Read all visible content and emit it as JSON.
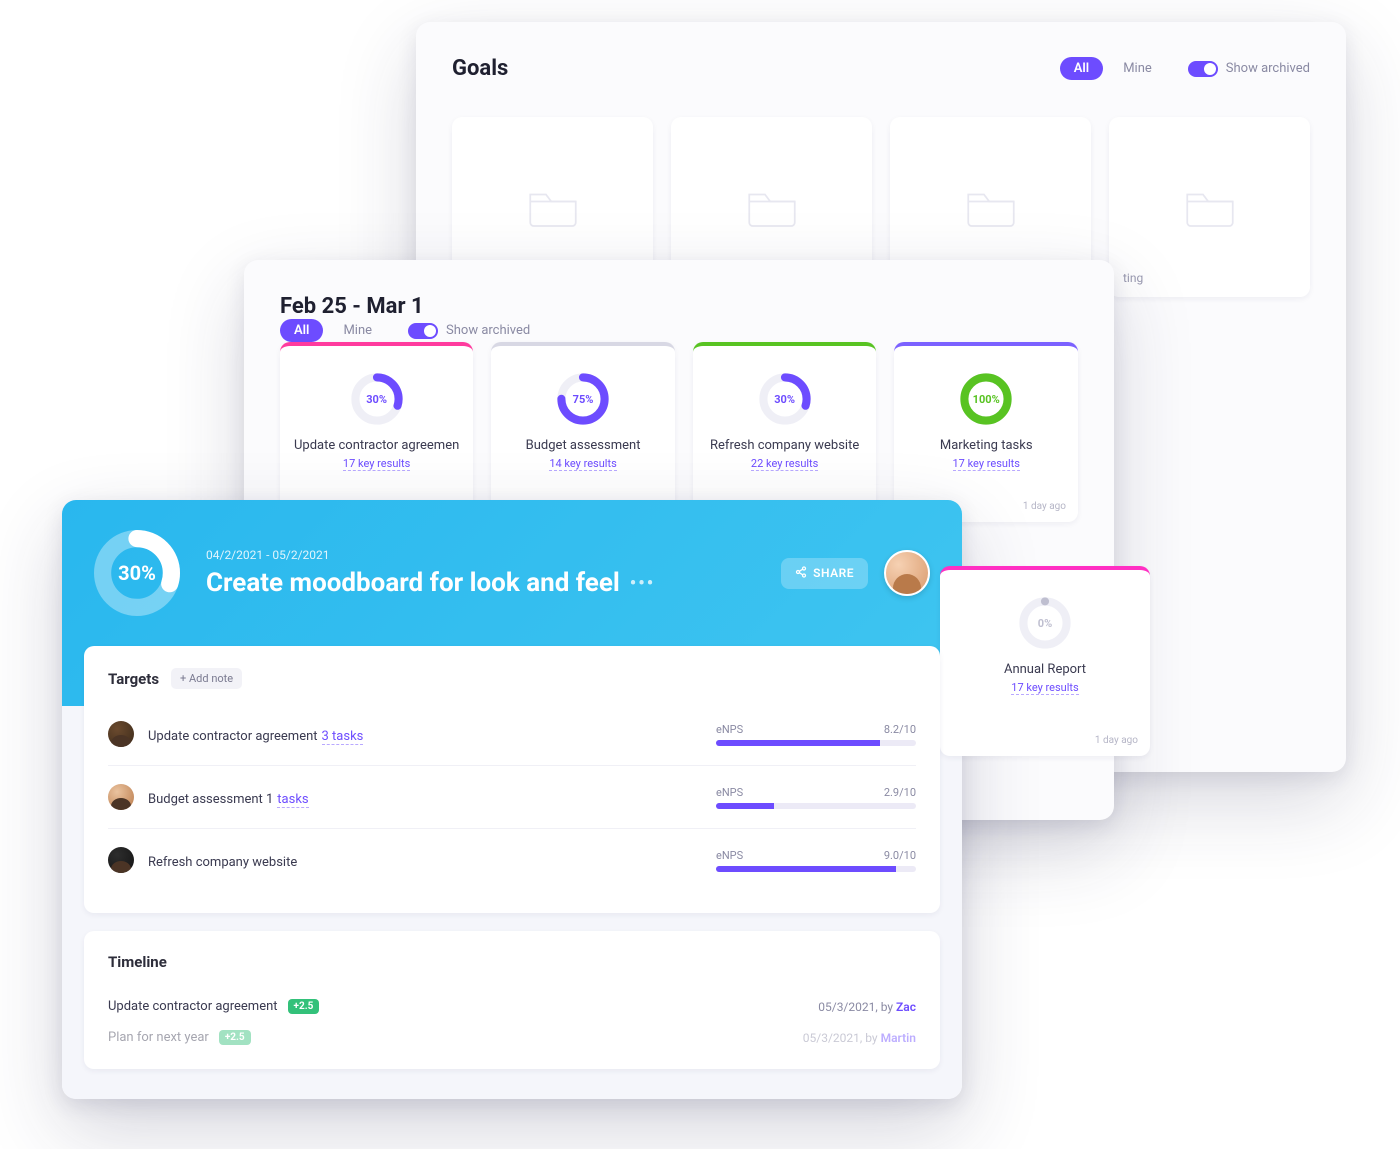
{
  "colors": {
    "accent": "#6d4cff",
    "hero": "#3fc5f0",
    "green": "#58c322",
    "pink": "#ff3b9e",
    "grey": "#bfbfd0"
  },
  "w1": {
    "title": "Goals",
    "filter": {
      "all": "All",
      "mine": "Mine",
      "archived": "Show archived"
    },
    "folders": [
      {
        "caption": ""
      },
      {
        "caption": ""
      },
      {
        "caption": ""
      },
      {
        "caption": "ting"
      }
    ],
    "goals_row2": [
      {
        "name": "Marketing tasks",
        "meta": "17 key results",
        "pct": 100,
        "color": "#58c322",
        "topbar": "#7b61ff",
        "ts": "1 day ago"
      }
    ],
    "extra_col": [
      {
        "pct": 0,
        "color": "#bfbfd0",
        "name": "Annual Report",
        "meta": "17 key results",
        "topbar": "#ff2fc3",
        "ts": "1 day ago"
      }
    ]
  },
  "w2": {
    "title": "Feb 25 - Mar 1",
    "filter": {
      "all": "All",
      "mine": "Mine",
      "archived": "Show archived"
    },
    "goals": [
      {
        "name": "Update contractor agreemen",
        "meta": "17 key results",
        "pct": 30,
        "color": "#6d4cff",
        "topbar": "#ff3b9e"
      },
      {
        "name": "Budget assessment",
        "meta": "14 key results",
        "pct": 75,
        "color": "#6d4cff",
        "topbar": "#d8d8e4"
      },
      {
        "name": "Refresh company website",
        "meta": "22 key results",
        "pct": 30,
        "color": "#6d4cff",
        "topbar": "#58c322"
      },
      {
        "name": "Marketing tasks",
        "meta": "17 key results",
        "pct": 100,
        "color": "#58c322",
        "topbar": "#7b61ff",
        "ts": "1 day ago"
      }
    ]
  },
  "detail": {
    "pct": 30,
    "daterange": "04/2/2021 - 05/2/2021",
    "title": "Create moodboard for look and feel",
    "share": "SHARE",
    "targets_heading": "Targets",
    "add_note": "+ Add note",
    "timeline_heading": "Timeline",
    "targets": [
      {
        "title": "Update contractor agreement",
        "tasks_label": "3 tasks",
        "enps_label": "eNPS",
        "score": "8.2/10",
        "bar_pct": 82
      },
      {
        "title": "Budget assessment 1",
        "tasks_label": "tasks",
        "enps_label": "eNPS",
        "score": "2.9/10",
        "bar_pct": 29
      },
      {
        "title": "Refresh company website",
        "tasks_label": "",
        "enps_label": "eNPS",
        "score": "9.0/10",
        "bar_pct": 90
      }
    ],
    "timeline": [
      {
        "title": "Update contractor agreement",
        "delta": "+2.5",
        "date": "05/3/2021, by",
        "by": "Zac"
      },
      {
        "title": "Plan for next year",
        "delta": "+2.5",
        "date": "05/3/2021, by",
        "by": "Martin",
        "faded": true
      }
    ]
  }
}
